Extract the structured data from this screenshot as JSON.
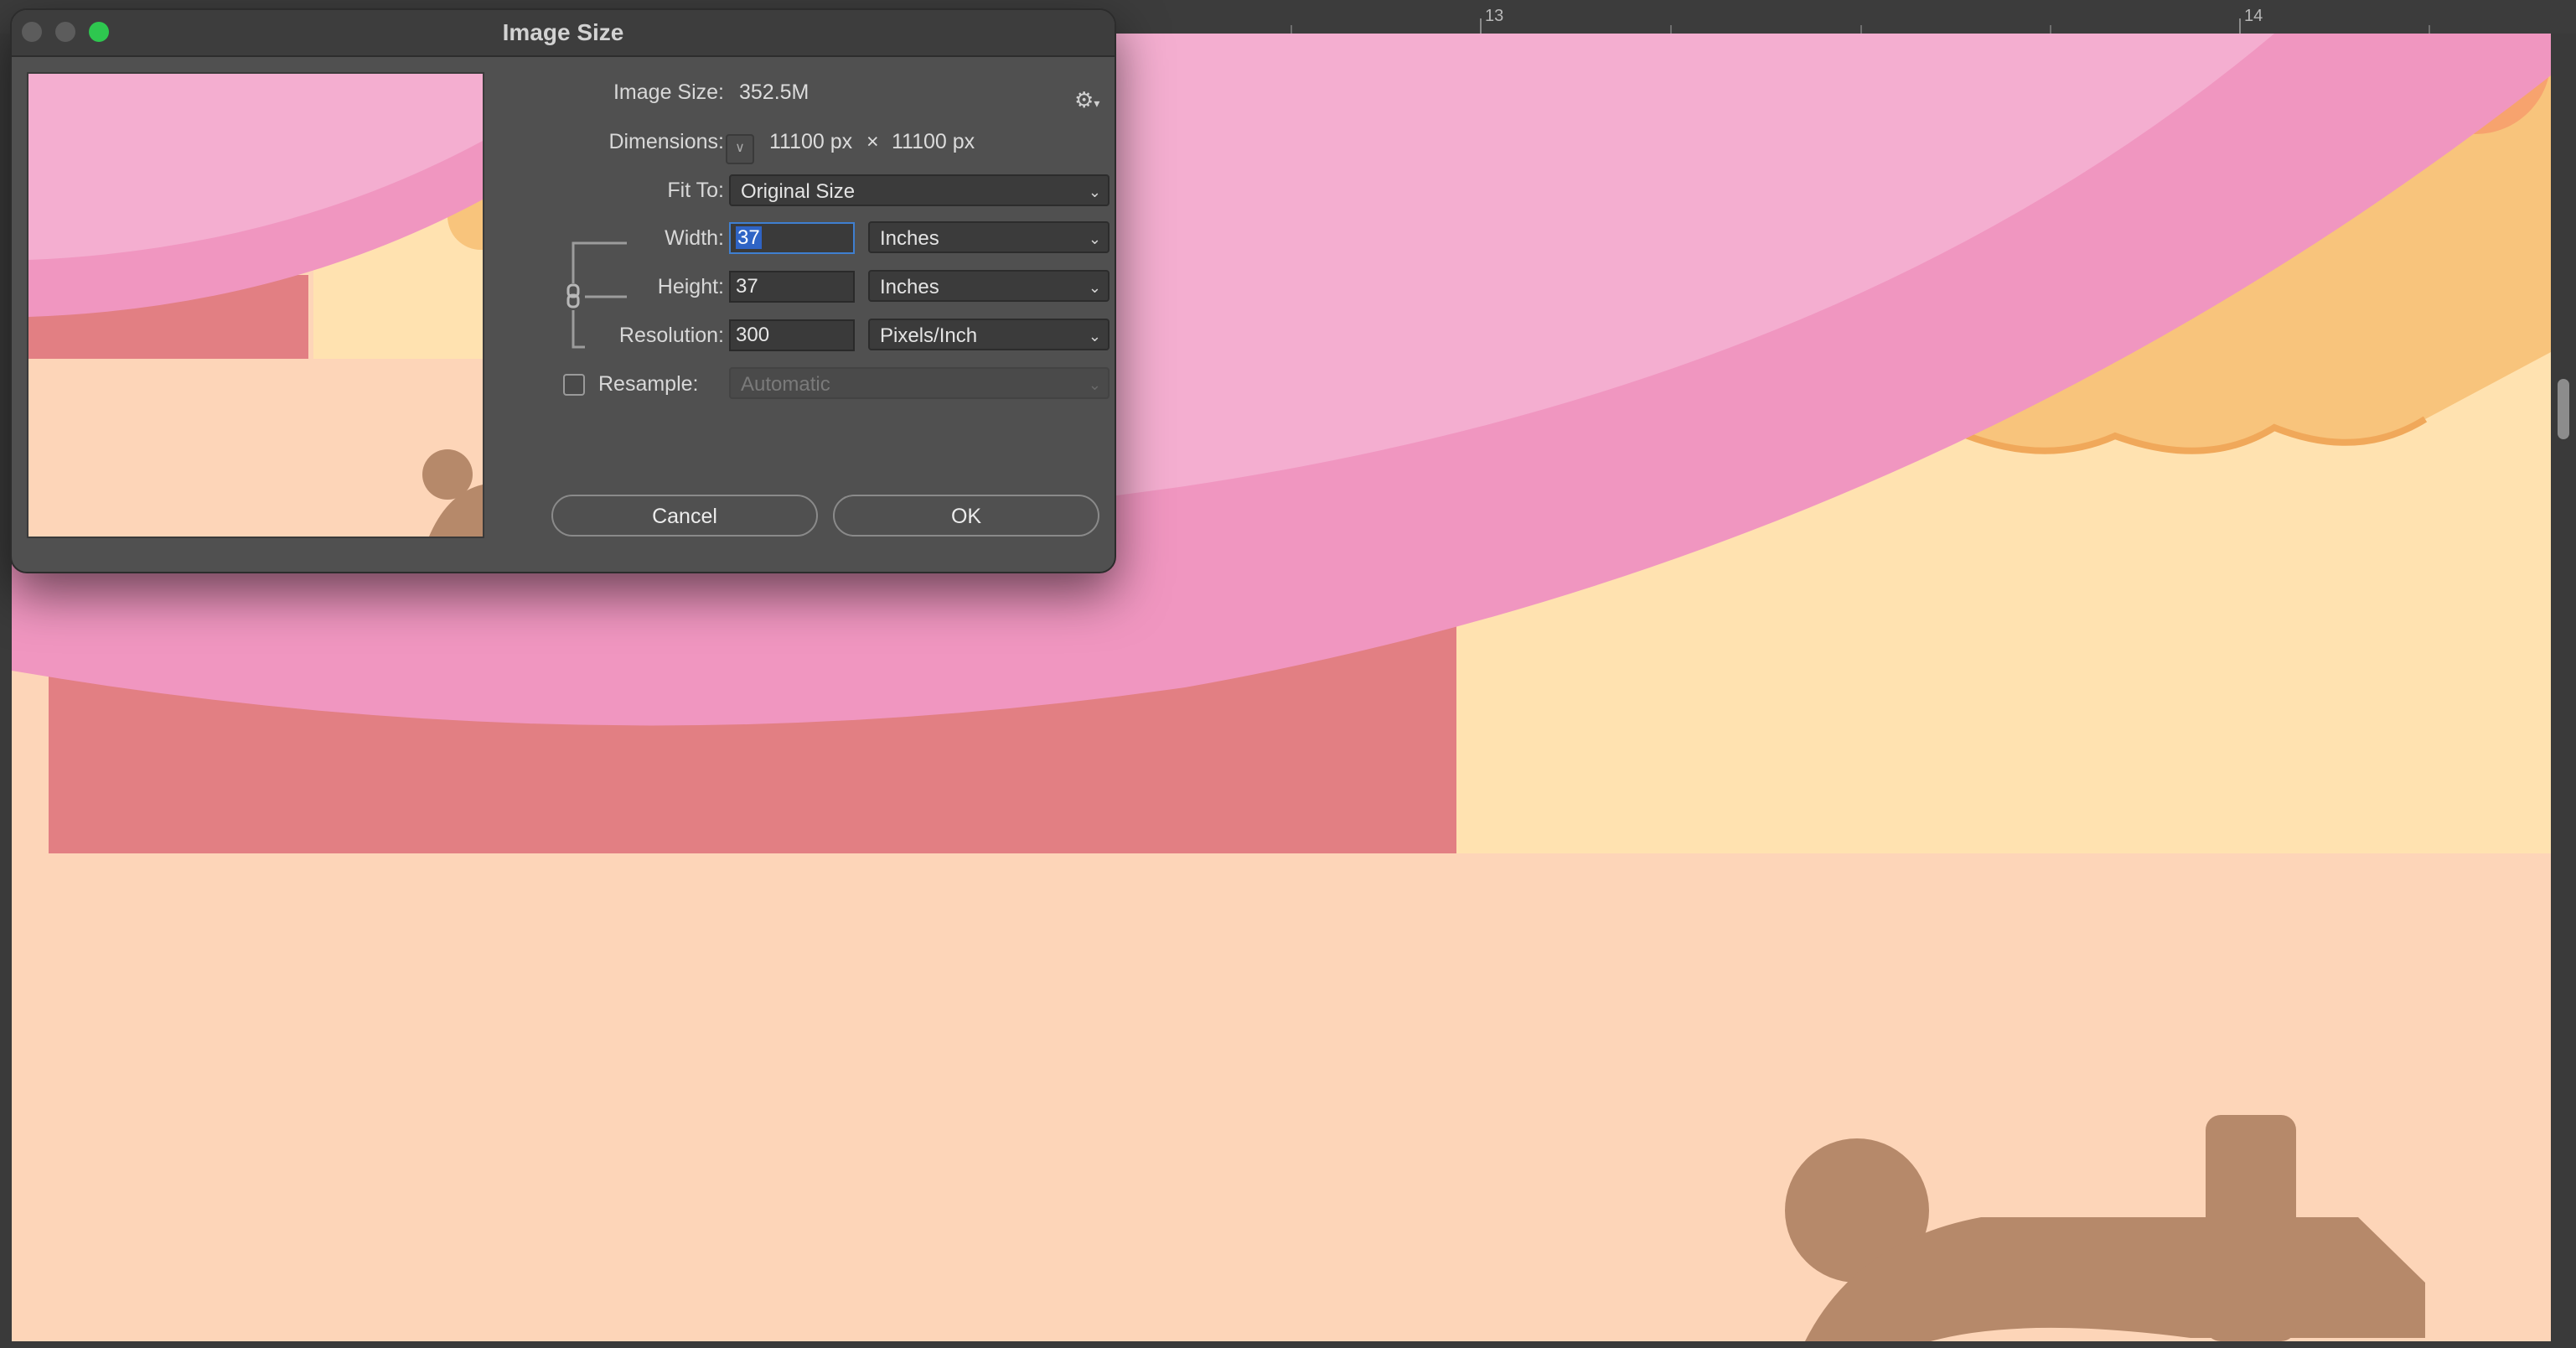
{
  "ruler": {
    "labels": [
      "13",
      "14"
    ]
  },
  "dialog": {
    "title": "Image Size",
    "image_size_label": "Image Size:",
    "image_size_value": "352.5M",
    "dimensions_label": "Dimensions:",
    "dimensions_width": "11100 px",
    "dimensions_times": "×",
    "dimensions_height": "11100 px",
    "fit_to_label": "Fit To:",
    "fit_to_value": "Original Size",
    "width_label": "Width:",
    "width_value": "37",
    "width_unit": "Inches",
    "height_label": "Height:",
    "height_value": "37",
    "height_unit": "Inches",
    "resolution_label": "Resolution:",
    "resolution_value": "300",
    "resolution_unit": "Pixels/Inch",
    "resample_label": "Resample:",
    "resample_checked": false,
    "resample_value": "Automatic",
    "cancel_label": "Cancel",
    "ok_label": "OK"
  },
  "icons": {
    "gear": "gear-icon",
    "chevron": "chevron-down-icon",
    "link": "chain-link-icon"
  },
  "colors": {
    "artwork_pink_light": "#f4aed0",
    "artwork_pink_band": "#f096c0",
    "artwork_red_block": "#e27f83",
    "artwork_yellow": "#ffe2b0",
    "artwork_peach": "#fdd5b8",
    "artwork_orange_cloud": "#f8c47c",
    "artwork_brown": "#b6896a",
    "ok_accent": "#2ec74f"
  }
}
